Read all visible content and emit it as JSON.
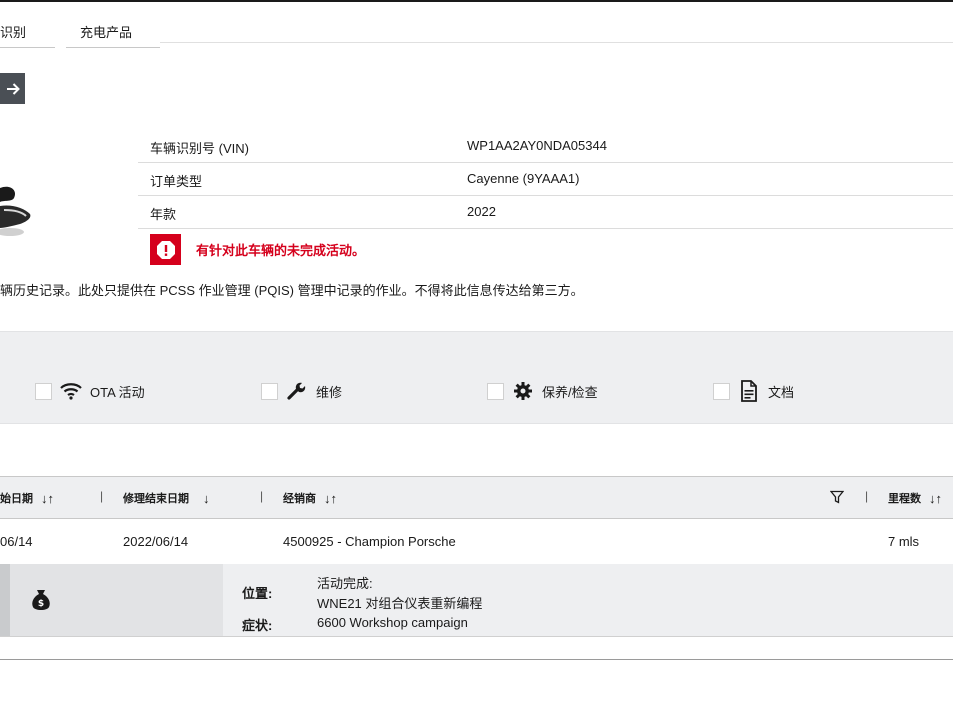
{
  "tabs": [
    {
      "label": "识别"
    },
    {
      "label": "充电产品"
    }
  ],
  "vehicle": {
    "rows": [
      {
        "label": "车辆识别号 (VIN)",
        "value": "WP1AA2AY0NDA05344"
      },
      {
        "label": "订单类型",
        "value": "Cayenne (9YAAA1)"
      },
      {
        "label": "年款",
        "value": "2022"
      }
    ],
    "alert": "有针对此车辆的未完成活动。"
  },
  "note": "辆历史记录。此处只提供在 PCSS 作业管理 (PQIS) 管理中记录的作业。不得将此信息传达给第三方。",
  "filters": [
    {
      "label": "OTA 活动",
      "icon": "wifi-icon"
    },
    {
      "label": "维修",
      "icon": "wrench-icon"
    },
    {
      "label": "保养/检查",
      "icon": "gear-icon"
    },
    {
      "label": "文档",
      "icon": "document-icon"
    }
  ],
  "table": {
    "headers": {
      "start_date": "始日期",
      "end_date": "修理结束日期",
      "dealer": "经销商",
      "mileage": "里程数"
    },
    "separator": "|",
    "rows": [
      {
        "start_date": "06/14",
        "end_date": "2022/06/14",
        "dealer": "4500925 - Champion Porsche",
        "mileage": "7 mls"
      }
    ],
    "detail": {
      "location_label": "位置:",
      "activity_label": "活动完成:",
      "activity_value": "WNE21 对组合仪表重新编程",
      "symptom_label": "症状:",
      "symptom_value": "6600 Workshop campaign"
    }
  },
  "colors": {
    "alert_red": "#d5001c",
    "panel_gray": "#eeeff1",
    "button_dark": "#4a4f55"
  }
}
